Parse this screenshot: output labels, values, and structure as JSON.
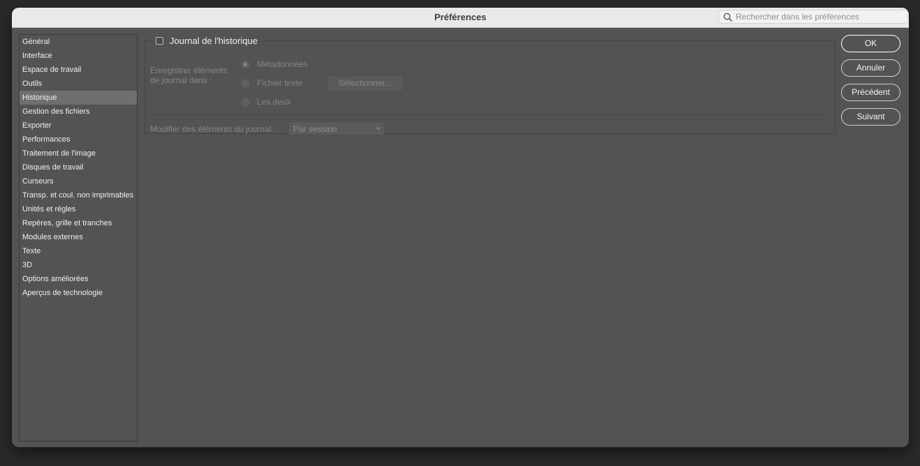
{
  "window": {
    "title": "Préférences",
    "search": {
      "placeholder": "Rechercher dans les préférences",
      "icon": "search-icon"
    }
  },
  "sidebar": {
    "active_index": 4,
    "items": [
      {
        "label": "Général"
      },
      {
        "label": "Interface"
      },
      {
        "label": "Espace de travail"
      },
      {
        "label": "Outils"
      },
      {
        "label": "Historique"
      },
      {
        "label": "Gestion des fichiers"
      },
      {
        "label": "Exporter"
      },
      {
        "label": "Performances"
      },
      {
        "label": "Traitement de l'image"
      },
      {
        "label": "Disques de travail"
      },
      {
        "label": "Curseurs"
      },
      {
        "label": "Transp. et coul. non imprimables"
      },
      {
        "label": "Unités et règles"
      },
      {
        "label": "Repères, grille et tranches"
      },
      {
        "label": "Modules externes"
      },
      {
        "label": "Texte"
      },
      {
        "label": "3D"
      },
      {
        "label": "Options améliorées"
      },
      {
        "label": "Aperçus de technologie"
      }
    ]
  },
  "history": {
    "enable_label": "Journal de l'historique",
    "enabled": false,
    "save_label": "Enregistrer éléments de journal dans :",
    "options": [
      {
        "label": "Métadonnées",
        "checked": true
      },
      {
        "label": "Fichier texte",
        "checked": false
      },
      {
        "label": "Les deux",
        "checked": false
      }
    ],
    "select_button": "Sélectionner...",
    "edit_label": "Modifier des éléments du journal :",
    "edit_value": "Par session"
  },
  "buttons": {
    "ok": "OK",
    "cancel": "Annuler",
    "previous": "Précédent",
    "next": "Suivant"
  },
  "colors": {
    "panel": "#535353",
    "titlebar": "#e9e9e9",
    "selected_item": "#6f6f6f"
  }
}
